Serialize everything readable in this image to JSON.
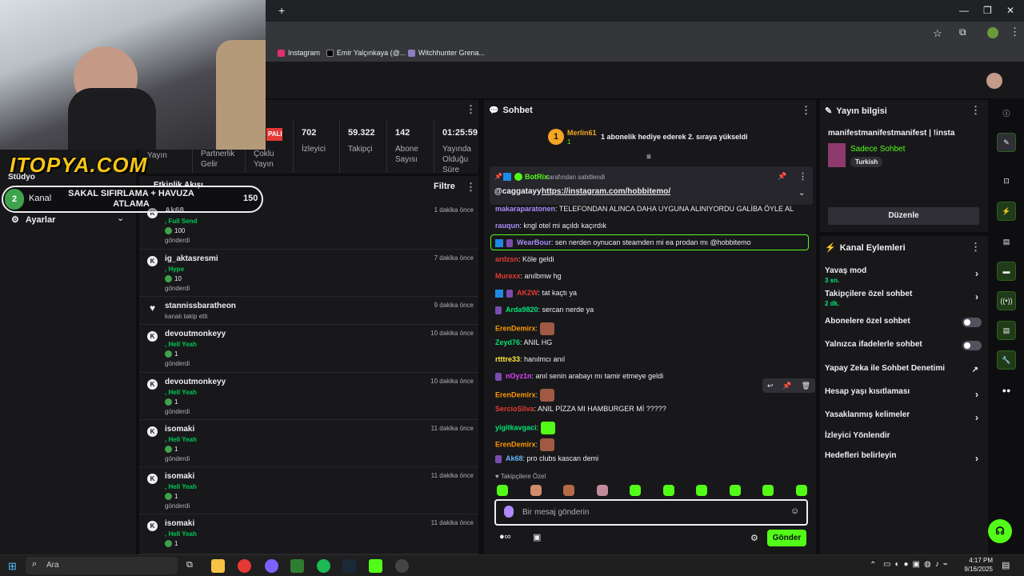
{
  "browser": {
    "bookmarks": [
      {
        "label": "Instagram",
        "icon": "instagram-icon"
      },
      {
        "label": "Emir Yalçınkaya (@...",
        "icon": "x-icon"
      },
      {
        "label": "Witchhunter Grena...",
        "icon": "shield-icon"
      }
    ]
  },
  "overlay": {
    "sponsor": "ITOPYA.COM",
    "goal_number": "2",
    "goal_text": "SAKAL SIFIRLAMA + HAVUZA ATLAMA",
    "goal_value": "150",
    "partial_studio": "Stüdyo",
    "sidebar_kanal": "Kanal",
    "sidebar_ayarlar": "Ayarlar",
    "live_badge": "PALI"
  },
  "stats": [
    {
      "value": "",
      "label": "Yayın"
    },
    {
      "value": "",
      "label": "Partnerlik Gelir"
    },
    {
      "value": "",
      "label": "Çoklu Yayın"
    },
    {
      "value": "702",
      "label": "İzleyici"
    },
    {
      "value": "59.322",
      "label": "Takipçi"
    },
    {
      "value": "142",
      "label": "Abone Sayısı"
    },
    {
      "value": "01:25:59",
      "label": "Yayında Olduğu Süre"
    }
  ],
  "activity": {
    "title": "Etkinlik Akışı",
    "filter": "Filtre",
    "items": [
      {
        "user": "Ak68",
        "type": "Full Send",
        "amount": "100",
        "action": "gönderdi",
        "time": "1 dakika önce"
      },
      {
        "user": "ig_aktasresmi",
        "type": "Hype",
        "amount": "10",
        "action": "gönderdi",
        "time": "7 dakika önce"
      },
      {
        "user": "stannissbaratheon",
        "type": "",
        "amount": "",
        "action": "kanalı takip etti",
        "time": "9 dakika önce"
      },
      {
        "user": "devoutmonkeyy",
        "type": "Hell Yeah",
        "amount": "1",
        "action": "gönderdi",
        "time": "10 dakika önce"
      },
      {
        "user": "devoutmonkeyy",
        "type": "Hell Yeah",
        "amount": "1",
        "action": "gönderdi",
        "time": "10 dakika önce"
      },
      {
        "user": "isomaki",
        "type": "Hell Yeah",
        "amount": "1",
        "action": "gönderdi",
        "time": "11 dakika önce"
      },
      {
        "user": "isomaki",
        "type": "Hell Yeah",
        "amount": "1",
        "action": "gönderdi",
        "time": "11 dakika önce"
      },
      {
        "user": "isomaki",
        "type": "Hell Yeah",
        "amount": "1",
        "action": "",
        "time": "11 dakika önce"
      }
    ]
  },
  "chat": {
    "title": "Sohbet",
    "gift_rank": "1",
    "gift_user": "Merlin61",
    "gift_count": "1",
    "gift_text": "1 abonelik hediye ederek 2. sıraya yükseldi",
    "pinned_by_user": "BotRix",
    "pinned_by_text": "tarafından sabitlendi",
    "pinned_mention": "@caggatayy",
    "pinned_link": "https://instagram.com/hobbitemo/",
    "messages": [
      {
        "user": "makaraparatonen",
        "color": "#a78bfa",
        "text": "TELEFONDAN ALINCA DAHA UYGUNA ALINIYORDU GALİBA ÖYLE AL"
      },
      {
        "user": "rauqun",
        "color": "#a78bfa",
        "text": "kngl otel mi açıldı kaçırdık"
      },
      {
        "user": "WearBour",
        "color": "#a78bfa",
        "text": "sen nerden oynucan steamden mi ea prodan mı @hobbitemo"
      },
      {
        "user": "ardzsn",
        "color": "#e53935",
        "text": "Köle geldi"
      },
      {
        "user": "Murexx",
        "color": "#e53935",
        "text": "anılbmw hg"
      },
      {
        "user": "AK2W",
        "color": "#e53935",
        "text": "tat kaçtı ya"
      },
      {
        "user": "Arda9820",
        "color": "#00e676",
        "text": "sercan nerde ya"
      },
      {
        "user": "ErenDemirx",
        "color": "#ff9800",
        "text": ""
      },
      {
        "user": "Zeyd76",
        "color": "#00e676",
        "text": "ANIL HG"
      },
      {
        "user": "rtttre33",
        "color": "#ffeb3b",
        "text": "hanılmcı anıl"
      },
      {
        "user": "nOyz1n",
        "color": "#e040fb",
        "text": "anıl senin arabayı mı tamir etmeye geldi"
      },
      {
        "user": "ErenDemirx",
        "color": "#ff9800",
        "text": ""
      },
      {
        "user": "SercioSilva",
        "color": "#e53935",
        "text": "ANIL PİZZA MI HAMBURGER Mİ ?????"
      },
      {
        "user": "yigitkavgaci",
        "color": "#00e676",
        "text": ""
      },
      {
        "user": "ErenDemirx",
        "color": "#ff9800",
        "text": ""
      },
      {
        "user": "Ak68",
        "color": "#64b5f6",
        "text": "pro clubs kascan demi"
      }
    ],
    "emote_bar_label": "Takipçilere Özel",
    "input_placeholder": "Bir mesaj gönderin",
    "send_label": "Gönder"
  },
  "stream_info": {
    "title": "Yayın bilgisi",
    "stream_title": "manifestmanifestmanifest | !insta",
    "category": "Sadece Sohbet",
    "tag": "Turkish",
    "edit_label": "Düzenle"
  },
  "channel_actions": {
    "title": "Kanal Eylemleri",
    "items": [
      {
        "label": "Yavaş mod",
        "sub": "3 sn.",
        "control": "chevron"
      },
      {
        "label": "Takipçilere özel sohbet",
        "sub": "2 dk.",
        "control": "chevron"
      },
      {
        "label": "Abonelere özel sohbet",
        "sub": "",
        "control": "toggle"
      },
      {
        "label": "Yalnızca ifadelerle sohbet",
        "sub": "",
        "control": "toggle"
      },
      {
        "label": "Yapay Zeka ile Sohbet Denetimi",
        "sub": "",
        "control": "external"
      },
      {
        "label": "Hesap yaşı kısıtlaması",
        "sub": "",
        "control": "chevron"
      },
      {
        "label": "Yasaklanmış kelimeler",
        "sub": "",
        "control": "chevron"
      },
      {
        "label": "İzleyici Yönlendir",
        "sub": "",
        "control": "none"
      },
      {
        "label": "Hedefleri belirleyin",
        "sub": "",
        "control": "chevron"
      }
    ]
  },
  "taskbar": {
    "search_placeholder": "Ara",
    "time": "4:17 PM",
    "date": "9/16/2025"
  },
  "colors": {
    "accent": "#53fc18",
    "bg": "#0e0e10",
    "panel": "#18181b"
  }
}
